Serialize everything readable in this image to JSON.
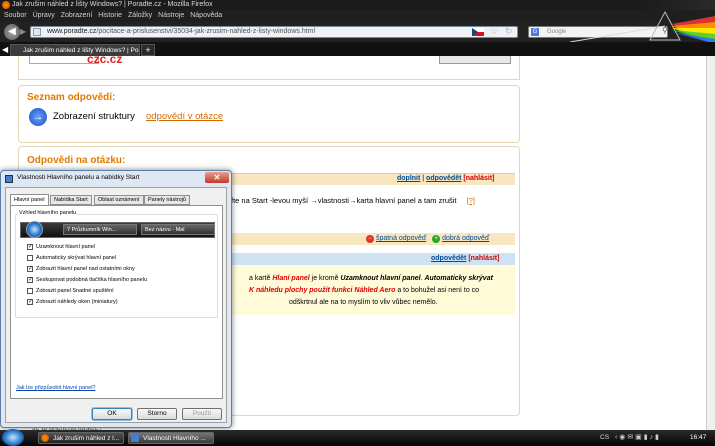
{
  "window": {
    "title": "Jak zrušim náhled z lišty Windows? | Poradte.cz - Mozilla Firefox"
  },
  "menu": [
    "Soubor",
    "Úpravy",
    "Zobrazení",
    "Historie",
    "Záložky",
    "Nástroje",
    "Nápověda"
  ],
  "nav": {
    "url_domain": "www.poradte.cz",
    "url_path": "/pocitace-a-prislusenstvi/35034-jak-zrusim-nahled-z-listy-windows.html",
    "search_placeholder": "Google"
  },
  "tabs": [
    {
      "label": "Jak zrušim náhled z lišty Windows? | Por...",
      "active": true
    }
  ],
  "page": {
    "top_logo": "czc.cz",
    "seznam": {
      "title": "Seznam odpovědí:",
      "text": "Zobrazení struktury",
      "link": "odpovědí v otázce"
    },
    "odpovedi": {
      "title": "Odpovědi na otázku:"
    },
    "answer1": {
      "actions": [
        "doplnit",
        "odpovědět",
        "[nahlásit]"
      ],
      "text": "fte na Start -levou myší →vlastnosti→karta hlavní panel a tam zrušit",
      "ref": "[?]",
      "bad": "špatná odpověď",
      "good": "dobrá odpověď"
    },
    "answer2": {
      "actions": [
        "odpovědět",
        "[nahlásit]"
      ],
      "l1a": "a kartě ",
      "l1b": "Hlaní panel",
      "l1c": " je kromě ",
      "l1d": "Uzamknout hlavní panel",
      "l1e": ". ",
      "l1f": "Automaticky skrývat",
      "l2a": "K náhledu plochy použít funkci Náhled Aero",
      "l2b": " a to bohužel asi není to co",
      "l3": "odškrtnul ale na to myslím to vliv vůbec nemělo."
    },
    "bottom_partial": "Je to oncheng funkce?"
  },
  "dialog": {
    "title": "Vlastnosti Hlavního panelu a nabídky Start",
    "tabs": [
      "Hlavní panel",
      "Nabídka Start",
      "Oblast oznámení",
      "Panely nástrojů"
    ],
    "group_label": "Vzhled hlavního panelu",
    "preview_items": [
      "7 Průzkumník Win...",
      "Bez názvu - Mal"
    ],
    "options": [
      {
        "label": "Uzamknout hlavní panel",
        "checked": true
      },
      {
        "label": "Automaticky skrývat hlavní panel",
        "checked": false
      },
      {
        "label": "Zobrazit hlavní panel nad ostatními okny",
        "checked": true
      },
      {
        "label": "Seskupovat podobná tlačítka hlavního panelu",
        "checked": true
      },
      {
        "label": "Zobrazit panel Snadné spuštění",
        "checked": false
      },
      {
        "label": "Zobrazit náhledy oken (miniatury)",
        "checked": true
      }
    ],
    "help_link": "Jak lze přizpůsobit hlavní panel?",
    "buttons": {
      "ok": "OK",
      "cancel": "Storno",
      "apply": "Použít"
    }
  },
  "taskbar": {
    "items": [
      "Jak zrušim náhled z l...",
      "Vlastnosti Hlavního ..."
    ],
    "lang": "CS",
    "time": "16:47"
  }
}
